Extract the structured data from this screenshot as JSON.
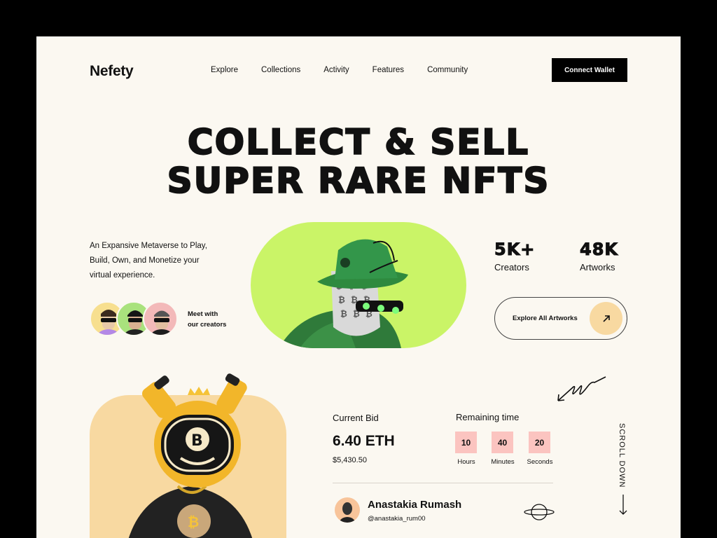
{
  "brand": "Nefety",
  "nav": [
    "Explore",
    "Collections",
    "Activity",
    "Features",
    "Community"
  ],
  "connect_label": "Connect Wallet",
  "hero": {
    "line1": "COLLECT & SELL",
    "line2": "SUPER RARE NFTS"
  },
  "tagline": "An Expansive Metaverse to Play, Build, Own, and Monetize your virtual experience.",
  "meet_creators": {
    "line1": "Meet with",
    "line2": "our creators"
  },
  "stats": [
    {
      "value": "5K+",
      "label": "Creators"
    },
    {
      "value": "48K",
      "label": "Artworks"
    }
  ],
  "explore_label": "Explore All Artworks",
  "bid": {
    "label": "Current Bid",
    "value": "6.40 ETH",
    "usd": "$5,430.50"
  },
  "remaining": {
    "label": "Remaining time",
    "units": [
      {
        "value": "10",
        "caption": "Hours"
      },
      {
        "value": "40",
        "caption": "Minutes"
      },
      {
        "value": "20",
        "caption": "Seconds"
      }
    ]
  },
  "owner": {
    "name": "Anastakia Rumash",
    "handle": "@anastakia_rum00"
  },
  "scroll_label": "SCROLL DOWN",
  "colors": {
    "background": "#fbf8f1",
    "accent_green": "#caf467",
    "accent_peach": "#f8d9a1",
    "timer_pink": "#fbc4c0"
  },
  "icons": [
    "arrow-up-right-icon",
    "planet-icon",
    "arrow-down-icon",
    "squiggle-arrow-icon"
  ]
}
